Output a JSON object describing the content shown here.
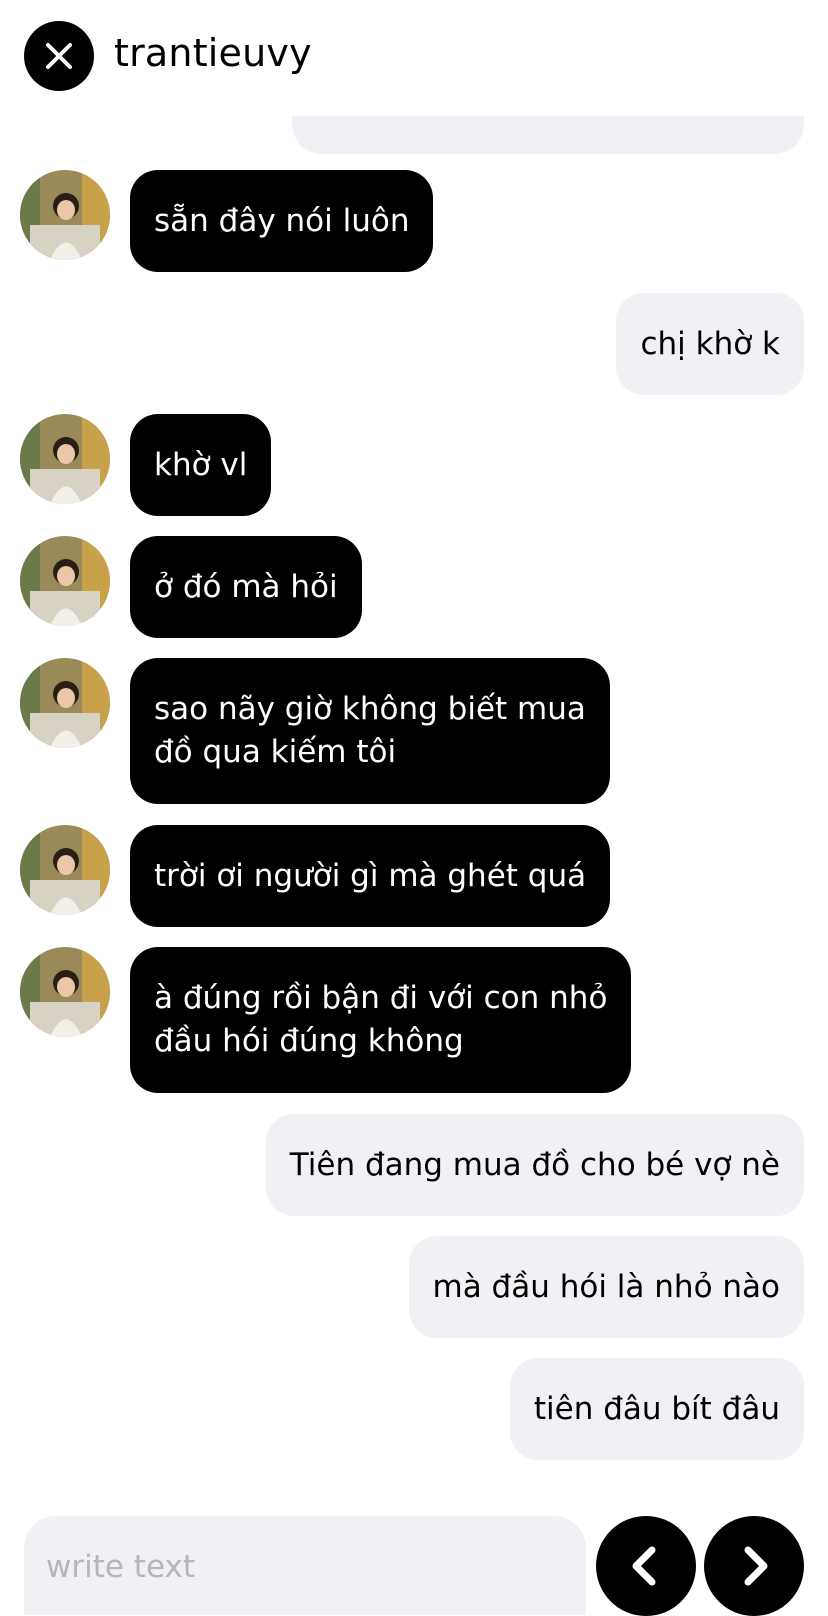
{
  "header": {
    "title": "trantieuvy",
    "close_icon": "close-icon"
  },
  "messages": [
    {
      "from": "them",
      "text": "sẵn đây nói luôn"
    },
    {
      "from": "me",
      "text": "chị khờ k"
    },
    {
      "from": "them",
      "text": "khờ vl"
    },
    {
      "from": "them",
      "text": "ở đó mà hỏi"
    },
    {
      "from": "them",
      "text": "sao nãy giờ không biết mua\nđồ qua kiếm tôi"
    },
    {
      "from": "them",
      "text": "trời ơi người gì mà ghét quá"
    },
    {
      "from": "them",
      "text": "à đúng rồi bận đi với con nhỏ\nđầu hói đúng không"
    },
    {
      "from": "me",
      "text": "Tiên đang mua đồ cho bé vợ nè"
    },
    {
      "from": "me",
      "text": "mà đầu hói là nhỏ nào"
    },
    {
      "from": "me",
      "text": "tiên đâu bít đâu"
    }
  ],
  "composer": {
    "placeholder": "write text",
    "prev_icon": "chevron-left-icon",
    "next_icon": "chevron-right-icon"
  },
  "colors": {
    "incoming_bubble": "#000000",
    "outgoing_bubble": "#f0f0f5",
    "placeholder": "#b5b5bb"
  }
}
